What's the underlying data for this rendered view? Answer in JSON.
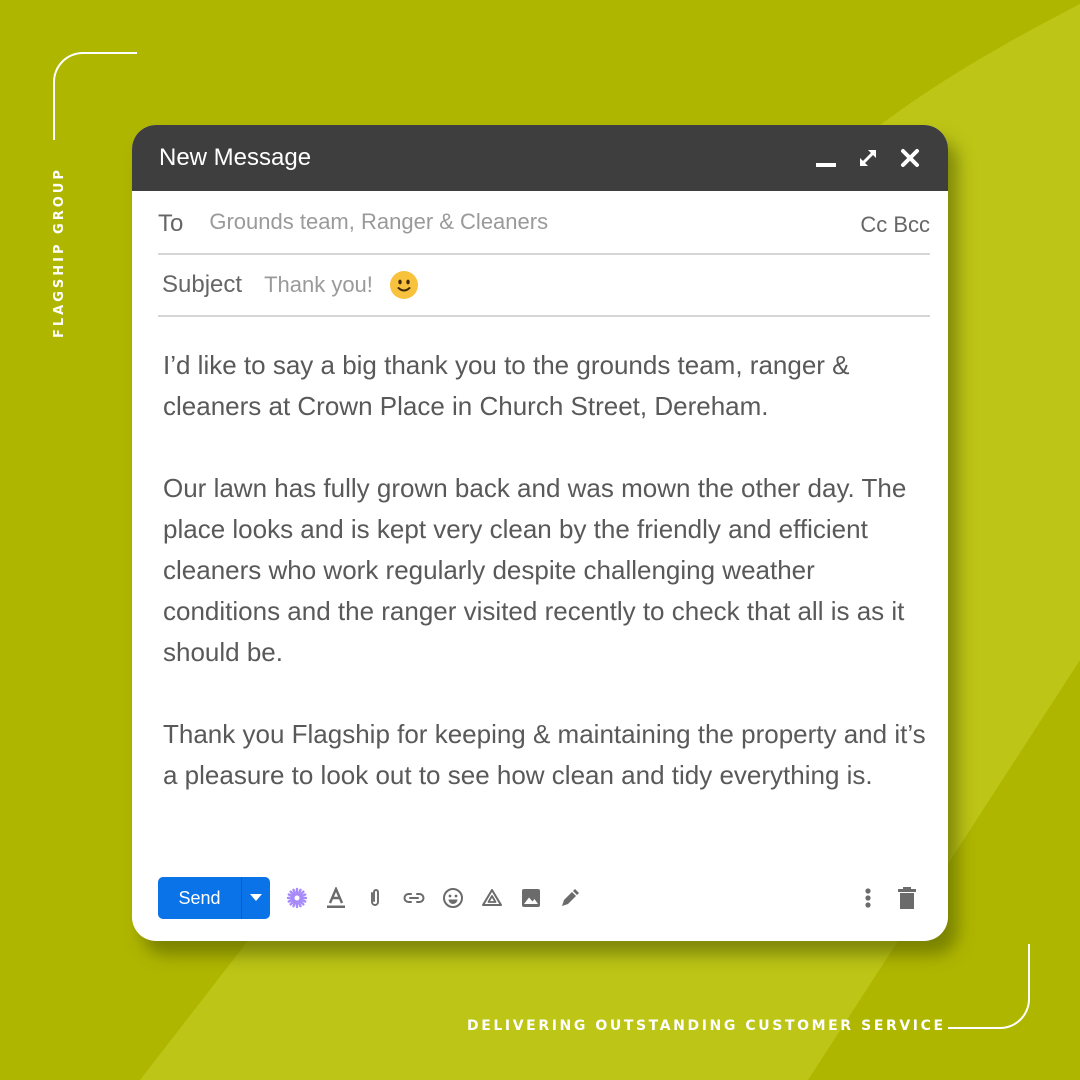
{
  "brand": {
    "name": "FLAGSHIP GROUP",
    "tagline": "DELIVERING OUTSTANDING CUSTOMER SERVICE"
  },
  "colors": {
    "background": "#afb600",
    "background_band": "#bdc516",
    "titlebar": "#3e3e3e",
    "send_button": "#0b73e8",
    "ai_icon": "#a78bfa",
    "emoji": "#f9c23c"
  },
  "compose": {
    "window_title": "New Message",
    "window_controls": [
      {
        "name": "minimize-icon"
      },
      {
        "name": "expand-icon"
      },
      {
        "name": "close-icon"
      }
    ],
    "to": {
      "label": "To",
      "value": "Grounds team, Ranger & Cleaners",
      "cc_bcc": "Cc Bcc"
    },
    "subject": {
      "label": "Subject",
      "value": "Thank you!",
      "emoji": "slightly-smiling-face"
    },
    "body": [
      "I’d like to say a big thank you to the grounds team, ranger & cleaners at Crown Place in Church Street, Dereham.",
      "Our lawn has fully grown back and was mown the other day. The place looks and is kept very clean by the friendly and efficient cleaners who work regularly despite challenging weather conditions and the ranger visited recently to check that all is as it should be.",
      "Thank you Flagship for keeping & maintaining the property and it’s a pleasure to look out to see how clean and tidy everything is."
    ],
    "toolbar": {
      "send_label": "Send",
      "icons": [
        "ai-sparkle-icon",
        "text-format-icon",
        "attach-icon",
        "link-icon",
        "emoji-icon",
        "drive-icon",
        "image-icon",
        "signature-pen-icon"
      ],
      "right_icons": [
        "more-options-icon",
        "trash-icon"
      ]
    }
  }
}
